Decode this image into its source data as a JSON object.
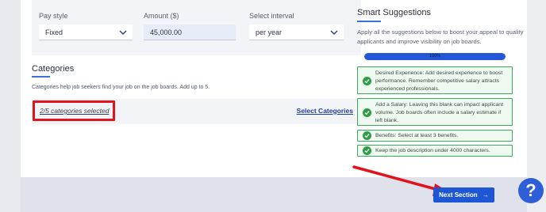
{
  "pay": {
    "style_label": "Pay style",
    "style_value": "Fixed",
    "amount_label": "Amount ($)",
    "amount_value": "45,000.00",
    "interval_label": "Select interval",
    "interval_value": "per year"
  },
  "categories": {
    "title": "Categories",
    "help": "Categories help job seekers find your job on the job boards. Add up to 5.",
    "selected_text": "2/5 categories selected",
    "select_link": "Select Categories"
  },
  "smart": {
    "title": "Smart Suggestions",
    "description": "Apply all the suggestions below to boost your appeal to quality applicants and improve visibility on job boards.",
    "progress_label": "100%",
    "progress_fraction": 1.0,
    "tips": [
      "Desired Experience: Add desired experience to boost performance. Remember competitive salary attracts experienced professionals.",
      "Add a Salary: Leaving this blank can impact applicant volume. Job boards often include a salary estimate if left blank.",
      "Benefits: Select at least 3 benefits.",
      "Keep the job description under 4000 characters."
    ]
  },
  "footer": {
    "next_label": "Next Section",
    "next_icon": "arrow-right-icon",
    "help_label": "?"
  },
  "colors": {
    "accent": "#1e57d6",
    "success": "#2f9c47",
    "annotation": "#e0141a"
  }
}
